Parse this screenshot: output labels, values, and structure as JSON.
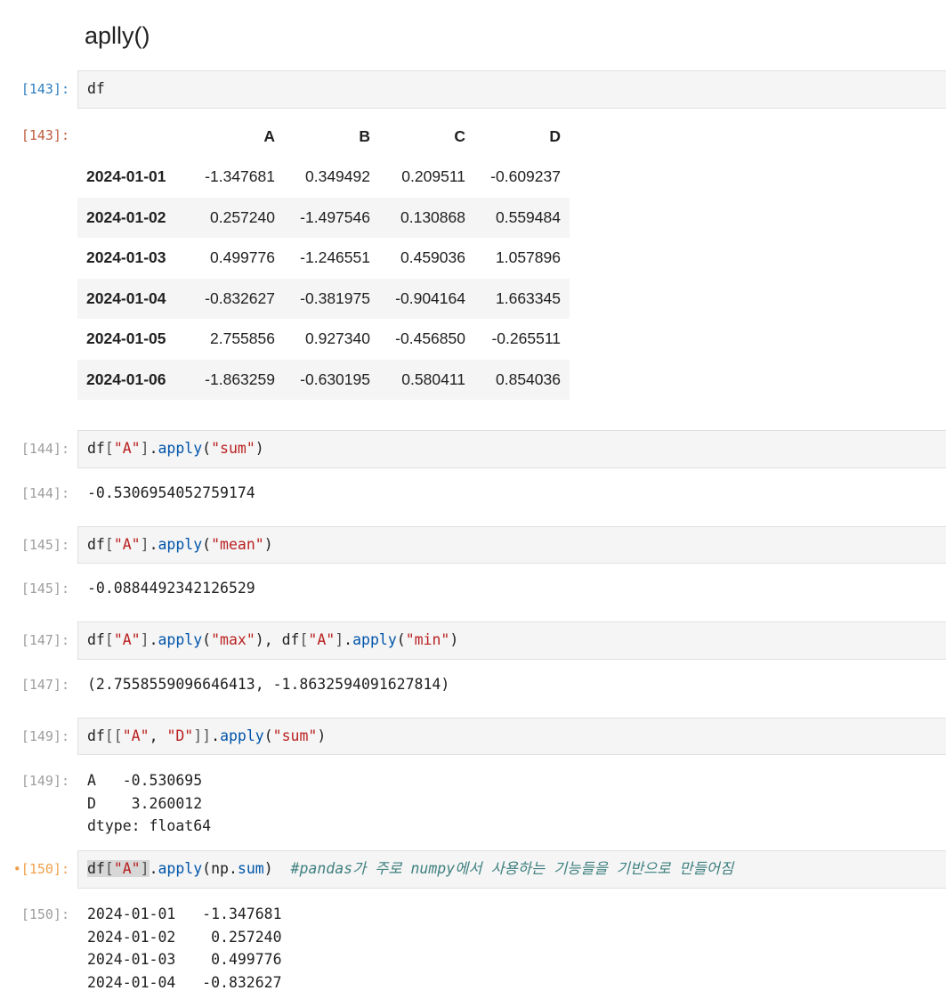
{
  "heading": "aplly()",
  "cells": [
    {
      "in_prompt": "[143]:",
      "code": "df",
      "out_prompt": "[143]:"
    },
    {
      "in_prompt": "[144]:",
      "out_prompt": "[144]:",
      "output": "-0.5306954052759174"
    },
    {
      "in_prompt": "[145]:",
      "out_prompt": "[145]:",
      "output": "-0.0884492342126529"
    },
    {
      "in_prompt": "[147]:",
      "out_prompt": "[147]:",
      "output": "(2.7558559096646413, -1.8632594091627814)"
    },
    {
      "in_prompt": "[149]:",
      "out_prompt": "[149]:",
      "output_lines": [
        "A   -0.530695",
        "D    3.260012",
        "dtype: float64"
      ]
    },
    {
      "in_prompt": "•[150]:",
      "out_prompt": "[150]:",
      "comment": "#pandas가 주로 numpy에서 사용하는 기능들을 기반으로 만들어짐",
      "output_lines": [
        "2024-01-01   -1.347681",
        "2024-01-02    0.257240",
        "2024-01-03    0.499776",
        "2024-01-04   -0.832627"
      ]
    }
  ],
  "dataframe": {
    "columns": [
      "A",
      "B",
      "C",
      "D"
    ],
    "rows": [
      {
        "index": "2024-01-01",
        "values": [
          "-1.347681",
          "0.349492",
          "0.209511",
          "-0.609237"
        ]
      },
      {
        "index": "2024-01-02",
        "values": [
          "0.257240",
          "-1.497546",
          "0.130868",
          "0.559484"
        ]
      },
      {
        "index": "2024-01-03",
        "values": [
          "0.499776",
          "-1.246551",
          "0.459036",
          "1.057896"
        ]
      },
      {
        "index": "2024-01-04",
        "values": [
          "-0.832627",
          "-0.381975",
          "-0.904164",
          "1.663345"
        ]
      },
      {
        "index": "2024-01-05",
        "values": [
          "2.755856",
          "0.927340",
          "-0.456850",
          "-0.265511"
        ]
      },
      {
        "index": "2024-01-06",
        "values": [
          "-1.863259",
          "-0.630195",
          "0.580411",
          "0.854036"
        ]
      }
    ]
  }
}
